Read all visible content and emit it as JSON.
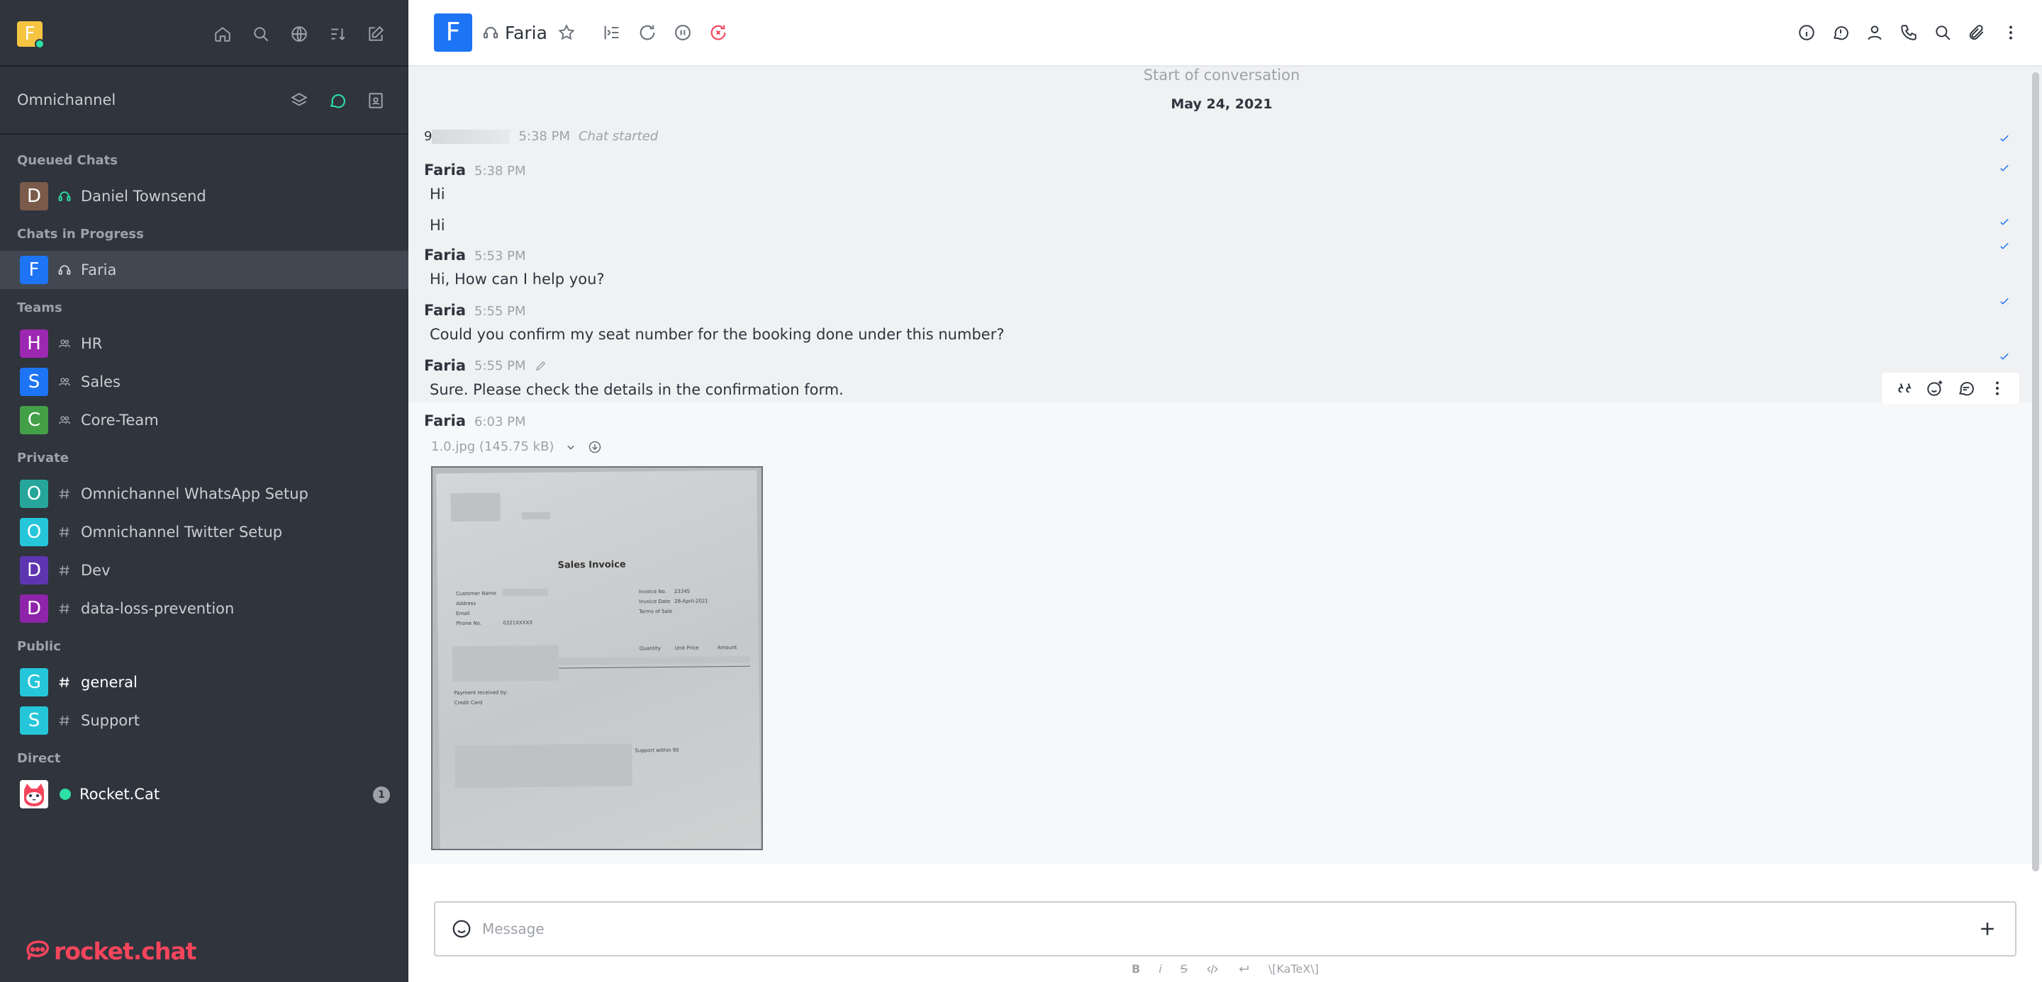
{
  "sidebar": {
    "app_initial": "F",
    "omnichannel_label": "Omnichannel",
    "sections": {
      "queued": "Queued Chats",
      "in_progress": "Chats in Progress",
      "teams": "Teams",
      "private": "Private",
      "public": "Public",
      "direct": "Direct"
    },
    "queued": [
      {
        "initial": "D",
        "label": "Daniel Townsend",
        "color": "#7a5a4a"
      }
    ],
    "in_progress": [
      {
        "initial": "F",
        "label": "Faria",
        "color": "#1d74f5"
      }
    ],
    "teams": [
      {
        "initial": "H",
        "label": "HR",
        "color": "#9c27b0"
      },
      {
        "initial": "S",
        "label": "Sales",
        "color": "#1d74f5"
      },
      {
        "initial": "C",
        "label": "Core-Team",
        "color": "#43a047"
      }
    ],
    "private": [
      {
        "initial": "O",
        "label": "Omnichannel WhatsApp Setup",
        "color": "#26a69a"
      },
      {
        "initial": "O",
        "label": "Omnichannel Twitter Setup",
        "color": "#26c6da"
      },
      {
        "initial": "D",
        "label": "Dev",
        "color": "#5e35b1"
      },
      {
        "initial": "D",
        "label": "data-loss-prevention",
        "color": "#8e24aa"
      }
    ],
    "public": [
      {
        "initial": "G",
        "label": "general",
        "color": "#26c6da"
      },
      {
        "initial": "S",
        "label": "Support",
        "color": "#26c6da"
      }
    ],
    "direct": [
      {
        "label": "Rocket.Cat",
        "badge": "1"
      }
    ],
    "logo_text": "rocket.chat"
  },
  "header": {
    "room_initial": "F",
    "room_name": "Faria"
  },
  "conversation": {
    "start_label": "Start of conversation",
    "date": "May 24, 2021",
    "system": {
      "user_prefix": "9",
      "time": "5:38 PM",
      "text": "Chat started"
    },
    "messages": [
      {
        "user": "Faria",
        "time": "5:38 PM",
        "lines": [
          "Hi",
          "Hi"
        ]
      },
      {
        "user": "Faria",
        "time": "5:53 PM",
        "text": "Hi, How can I help you?"
      },
      {
        "user": "Faria",
        "time": "5:55 PM",
        "text": "Could you confirm my seat number for the booking done under this number?"
      },
      {
        "user": "Faria",
        "time": "5:55 PM",
        "text": "Sure. Please check the details in the confirmation form."
      },
      {
        "user": "Faria",
        "time": "6:03 PM",
        "file_name": "1.0.jpg (145.75 kB)"
      }
    ],
    "invoice": {
      "title": "Sales Invoice",
      "customer_name": "Customer Name",
      "address": "Address",
      "email": "Email",
      "phone": "Phone No.",
      "phone_val": "0321XXXXX",
      "invoice_no": "Invoice No.",
      "invoice_no_val": "23345",
      "invoice_date": "Invoice Date",
      "invoice_date_val": "28-April-2021",
      "terms": "Terms of Sale",
      "quantity": "Quantity",
      "unit_price": "Unit Price",
      "amount": "Amount",
      "payment": "Payment received by:",
      "credit": "Credit Card",
      "support": "Support within 90"
    }
  },
  "composer": {
    "placeholder": "Message",
    "fmt_bold": "B",
    "fmt_italic": "i",
    "fmt_strike": "S",
    "fmt_katex": "\\[KaTeX\\]"
  }
}
